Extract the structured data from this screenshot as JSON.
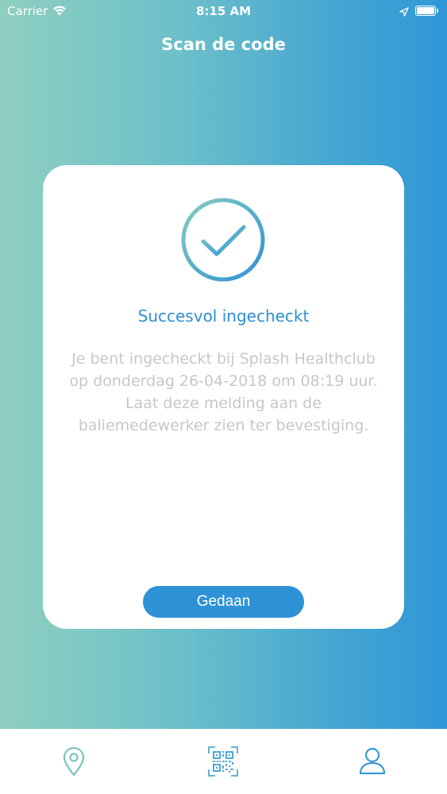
{
  "status_bar": {
    "carrier": "Carrier",
    "time": "8:15 AM"
  },
  "nav": {
    "title": "Scan de code"
  },
  "card": {
    "title": "Succesvol ingecheckt",
    "message": "Je bent ingecheckt bij Splash Healthclub op donderdag 26-04-2018 om 08:19 uur. Laat deze melding aan de baliemedewerker zien ter bevestiging.",
    "button_label": "Gedaan"
  },
  "tab_bar": {
    "items": [
      {
        "icon": "location-pin-icon",
        "active": false
      },
      {
        "icon": "qr-code-icon",
        "active": true
      },
      {
        "icon": "profile-icon",
        "active": false
      }
    ]
  },
  "colors": {
    "accent": "#2f92d6",
    "gradient_start": "#8fcfbf",
    "gradient_end": "#2f97d6",
    "message_text": "#c7c7c7"
  }
}
